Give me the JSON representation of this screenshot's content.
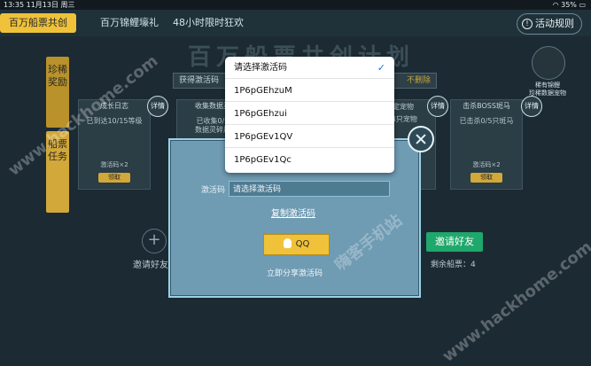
{
  "status_bar": {
    "time": "13:35",
    "date": "11月13日 周三",
    "battery": "35%"
  },
  "tabs": [
    {
      "label": "百万船票共创"
    },
    {
      "label": "百万锦鲤壕礼"
    },
    {
      "label": "48小时限时狂欢"
    }
  ],
  "rules_button": {
    "label": "活动规则",
    "icon": "info-icon"
  },
  "banner": {
    "title": "百万船票共创计划"
  },
  "info_strip": {
    "text": "获得激活码",
    "end": "不删除"
  },
  "side_tabs": [
    {
      "label": "珍稀奖励"
    },
    {
      "label": "船票任务"
    }
  ],
  "cards": [
    {
      "header": "成长日志",
      "sub": "已到达10/15等级",
      "reward": "激活码×2",
      "button": "领取"
    },
    {
      "header": "收集数据灵",
      "sub": "已收集0/2",
      "sub2": "数据灵碎片",
      "reward": "",
      "button": ""
    },
    {
      "header": "击杀BOSS斑马",
      "sub": "已击杀0/5只斑马",
      "reward": "激活码×2",
      "button": "领取"
    }
  ],
  "partial_card_text": {
    "line1": "定宠物",
    "line2": "/4只宠物"
  },
  "detail_label": "详情",
  "avatar": {
    "caption1": "稀有锦鲤",
    "caption2": "珍稀数据宠物"
  },
  "invite": {
    "plus": "+",
    "left_label": "邀请好友",
    "button": "邀请好友",
    "remain": "剩余船票：4"
  },
  "dialog": {
    "code_label": "激活码",
    "code_value": "请选择激活码",
    "copy_link": "复制激活码",
    "qq_button": "QQ",
    "share_text": "立即分享激活码"
  },
  "dropdown": {
    "options": [
      "请选择激活码",
      "1P6pGEhzuM",
      "1P6pGEhzui",
      "1P6pGEv1QV",
      "1P6pGEv1Qc"
    ],
    "selected_index": 0,
    "check": "✓"
  },
  "watermarks": [
    "www.hackhome.com",
    "嗨客手机站",
    "www.hackhome.com"
  ],
  "colors": {
    "accent": "#f0c23a",
    "invite_green": "#1fa86c",
    "dialog_bg": "#6f9bb3",
    "check_blue": "#1a72e8"
  }
}
